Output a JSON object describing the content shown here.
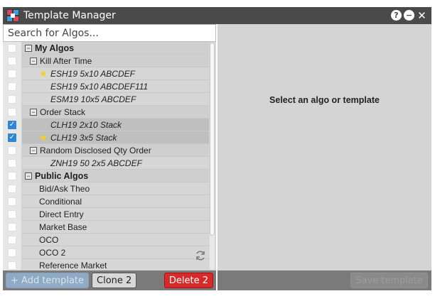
{
  "window": {
    "title": "Template Manager"
  },
  "title_controls": {
    "help_icon": "?",
    "minimize_icon": "−",
    "close_icon": "✕"
  },
  "search": {
    "placeholder": "Search for Algos..."
  },
  "tree": {
    "my_algos": {
      "label": "My Algos",
      "toggle": "−"
    },
    "kill_after_time": {
      "label": "Kill After Time",
      "toggle": "−"
    },
    "kat_items": [
      {
        "label": "ESH19 5x10 ABCDEF",
        "starred": true,
        "checked": false
      },
      {
        "label": "ESH19 5x10 ABCDEF111",
        "starred": false,
        "checked": false
      },
      {
        "label": "ESM19 10x5 ABCDEF",
        "starred": false,
        "checked": false
      }
    ],
    "order_stack": {
      "label": "Order Stack",
      "toggle": "−"
    },
    "os_items": [
      {
        "label": "CLH19 2x10 Stack",
        "starred": false,
        "checked": true
      },
      {
        "label": "CLH19 3x5 Stack",
        "starred": true,
        "checked": true
      }
    ],
    "random_disclosed": {
      "label": "Random Disclosed Qty Order",
      "toggle": "−"
    },
    "rd_items": [
      {
        "label": "ZNH19 50 2x5 ABCDEF",
        "starred": false,
        "checked": false
      }
    ],
    "public_algos": {
      "label": "Public Algos",
      "toggle": "−"
    },
    "public_items": [
      {
        "label": "Bid/Ask Theo"
      },
      {
        "label": "Conditional"
      },
      {
        "label": "Direct Entry"
      },
      {
        "label": "Market Base"
      },
      {
        "label": "OCO"
      },
      {
        "label": "OCO 2"
      },
      {
        "label": "Reference Market"
      }
    ]
  },
  "detail": {
    "empty_message": "Select an algo or template"
  },
  "buttons": {
    "add": "+ Add template",
    "clone": "Clone 2",
    "delete": "Delete 2",
    "save": "Save template"
  },
  "colors": {
    "titlebar": "#4a4a4a",
    "checkbox_checked": "#2f86d6",
    "delete": "#d62b2b",
    "star": "#f7d117"
  }
}
